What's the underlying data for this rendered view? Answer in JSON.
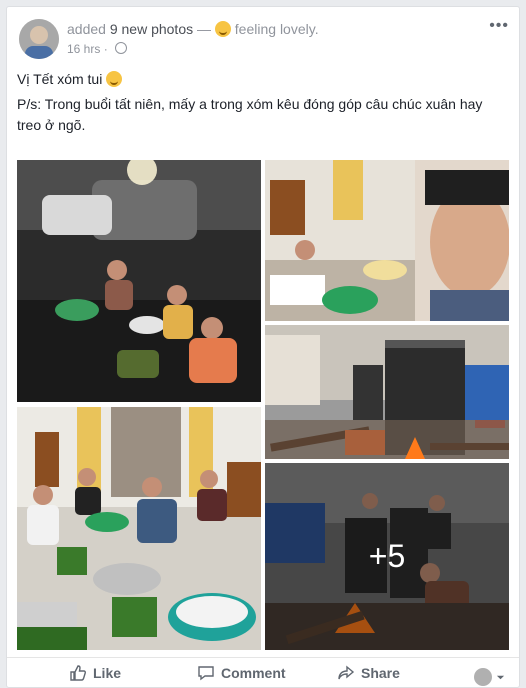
{
  "post": {
    "action_text": "added",
    "photo_count_text": "9 new photos",
    "separator": "—",
    "feeling_text": "feeling lovely.",
    "time": "16 hrs",
    "more_label": "•••",
    "line1": "Vị Tết xóm tui",
    "line2": "P/s: Trong buổi tất niên, mấy a trong xóm kêu đóng góp câu chúc xuân hay treo ở ngõ.",
    "more_photos": "+5"
  },
  "actions": {
    "like": "Like",
    "comment": "Comment",
    "share": "Share"
  },
  "icons": {
    "avatar": "profile-avatar",
    "privacy": "globe-icon",
    "feeling": "smile-emoji-icon",
    "like": "thumbs-up-icon",
    "comment": "speech-bubble-icon",
    "share": "share-arrow-icon",
    "viewer": "avatar-dropdown-icon"
  }
}
